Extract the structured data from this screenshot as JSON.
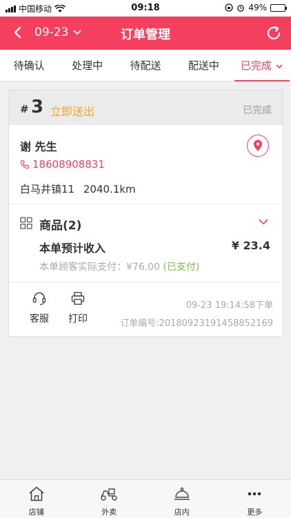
{
  "status_bar": {
    "carrier": "中国移动",
    "time": "09:18",
    "battery": "49%",
    "battery_level": 0.49
  },
  "nav": {
    "date": "09-23",
    "title": "订单管理"
  },
  "tabs": [
    {
      "label": "待确认"
    },
    {
      "label": "处理中"
    },
    {
      "label": "待配送"
    },
    {
      "label": "配送中"
    },
    {
      "label": "已完成"
    }
  ],
  "order": {
    "hash": "#",
    "number": "3",
    "mode": "立即送出",
    "status": "已完成",
    "customer_name": "谢 先生",
    "phone": "18608908831",
    "address": "白马井镇11",
    "distance": "2040.1km",
    "goods_label": "商品(2)",
    "income_label": "本单预计收入",
    "income_value": "¥ 23.4",
    "paid_prefix": "本单顾客实际支付：¥76.00",
    "paid_status": "(已支付)",
    "order_time": "09-23 19:14:58下单",
    "order_no": "订单编号:2018092319145885216​9",
    "service_label": "客服",
    "print_label": "打印"
  },
  "bottom_nav": [
    {
      "label": "店铺",
      "icon": "shop-icon"
    },
    {
      "label": "外卖",
      "icon": "scooter-icon"
    },
    {
      "label": "店内",
      "icon": "cloche-icon"
    },
    {
      "label": "更多",
      "icon": "more-icon"
    }
  ],
  "colors": {
    "brand": "#f43f5e",
    "accent_orange": "#f5a623",
    "paid_green": "#7bc043"
  }
}
